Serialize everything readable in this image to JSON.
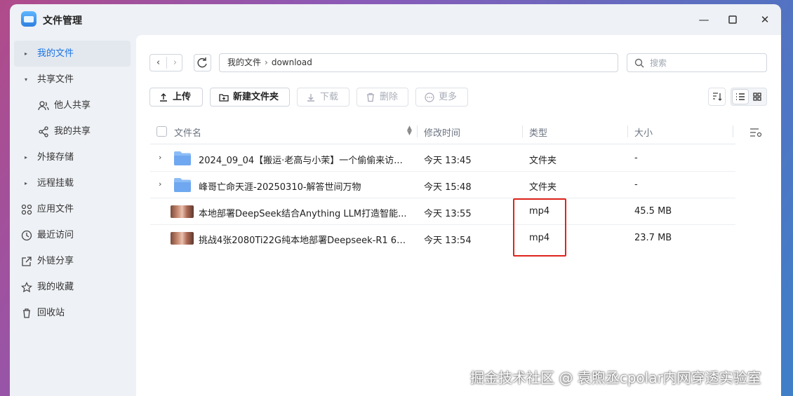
{
  "app": {
    "title": "文件管理",
    "icon": "folder-app-icon"
  },
  "window_controls": {
    "minimize": "—",
    "maximize": "☐",
    "close": "✕"
  },
  "sidebar": {
    "items": [
      {
        "label": "我的文件",
        "icon": "caret-icon",
        "active": true
      },
      {
        "label": "共享文件",
        "icon": "caret-down-icon"
      },
      {
        "label": "他人共享",
        "icon": "users-icon"
      },
      {
        "label": "我的共享",
        "icon": "share-icon"
      },
      {
        "label": "外接存储",
        "icon": "caret-icon"
      },
      {
        "label": "远程挂载",
        "icon": "caret-icon"
      },
      {
        "label": "应用文件",
        "icon": "apps-icon"
      },
      {
        "label": "最近访问",
        "icon": "clock-icon"
      },
      {
        "label": "外链分享",
        "icon": "external-share-icon"
      },
      {
        "label": "我的收藏",
        "icon": "star-icon"
      },
      {
        "label": "回收站",
        "icon": "trash-icon"
      }
    ]
  },
  "nav": {
    "path": [
      "我的文件",
      "download"
    ],
    "search_placeholder": "搜索"
  },
  "toolbar": {
    "upload": "上传",
    "new_folder": "新建文件夹",
    "download": "下载",
    "delete": "删除",
    "more": "更多"
  },
  "table": {
    "headers": {
      "name": "文件名",
      "modified": "修改时间",
      "type": "类型",
      "size": "大小"
    },
    "rows": [
      {
        "name": "2024_09_04【搬运·老高与小茉】一个偷偷来访...",
        "modified": "今天 13:45",
        "type": "文件夹",
        "size": "-",
        "kind": "folder"
      },
      {
        "name": "峰哥亡命天涯-20250310-解答世间万物",
        "modified": "今天 15:48",
        "type": "文件夹",
        "size": "-",
        "kind": "folder"
      },
      {
        "name": "本地部署DeepSeek结合Anything LLM打造智能...",
        "modified": "今天 13:55",
        "type": "mp4",
        "size": "45.5 MB",
        "kind": "video"
      },
      {
        "name": "挑战4张2080Ti22G纯本地部署Deepseek-R1 67...",
        "modified": "今天 13:54",
        "type": "mp4",
        "size": "23.7 MB",
        "kind": "video"
      }
    ]
  },
  "watermark": "掘金技术社区 @ 袁煦丞cpolar内网穿透实验室",
  "colors": {
    "accent": "#1b74e4",
    "highlight": "#e0241b",
    "folder": "#7fb3f5"
  }
}
